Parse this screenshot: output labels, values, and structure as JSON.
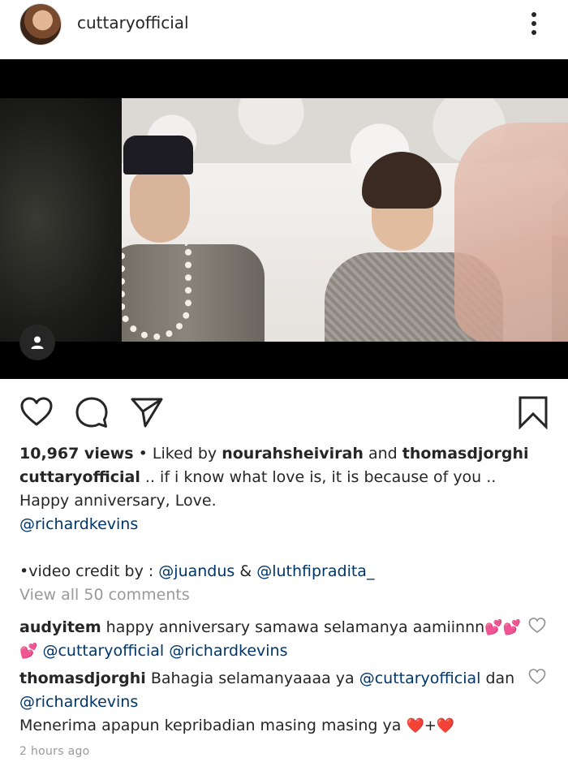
{
  "post": {
    "username": "cuttaryofficial",
    "views": "10,967 views",
    "liked_by_prefix": " • Liked by ",
    "liked_by_user1": "nourahsheivirah",
    "liked_and": " and ",
    "liked_by_user2": "thomasdjorghi",
    "caption_user": "cuttaryofficial",
    "caption_line1": " .. if i know what love is, it is because of you ..",
    "caption_line2": "Happy anniversary, Love.",
    "caption_mention": "@richardkevins",
    "credit_prefix": "•video credit by : ",
    "credit_mention1": "@juandus",
    "credit_amp": " & ",
    "credit_mention2": "@luthfipradita_",
    "view_comments": "View all 50 comments",
    "timestamp": "2 hours ago"
  },
  "comments": [
    {
      "user": "audyitem",
      "text1": " happy anniversary samawa selamanya aamiinnn",
      "emoji1": "💕💕",
      "emoji2": "💕",
      "mention1": "@cuttaryofficial",
      "mention2": "@richardkevins"
    },
    {
      "user": "thomasdjorghi",
      "text1": " Bahagia selamanyaaaa ya ",
      "mention1": "@cuttaryofficial",
      "text2": " dan",
      "mention2": "@richardkevins",
      "text3": "Menerima apapun kepribadian masing masing ya ",
      "emoji": "❤️+❤️"
    }
  ],
  "icons": {
    "more": "more-vertical-icon",
    "user_tag": "person-icon",
    "like": "heart-icon",
    "comment": "comment-bubble-icon",
    "share": "paper-plane-icon",
    "save": "bookmark-icon",
    "comment_like": "heart-outline-icon"
  },
  "colors": {
    "text": "#262626",
    "link": "#003569",
    "muted": "#999999",
    "media_bg": "#000000"
  }
}
